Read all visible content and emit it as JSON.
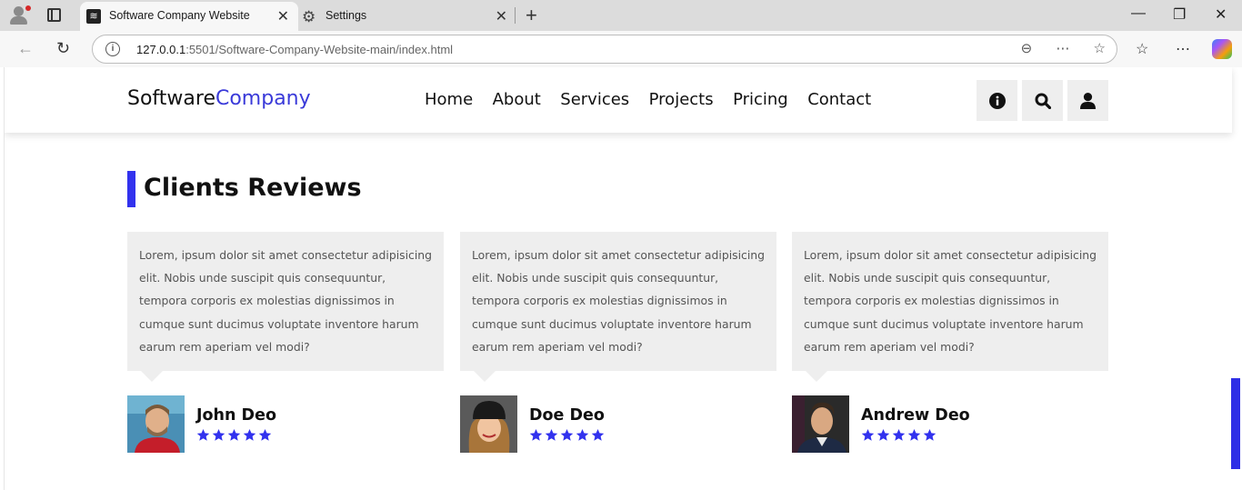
{
  "browser": {
    "tabs": [
      {
        "title": "Software Company Website",
        "active": true
      },
      {
        "title": "Settings",
        "active": false
      }
    ],
    "url_host": "127.0.0.1",
    "url_rest": ":5501/Software-Company-Website-main/index.html"
  },
  "site": {
    "logo_main": "Software",
    "logo_accent": "Company",
    "nav": [
      "Home",
      "About",
      "Services",
      "Projects",
      "Pricing",
      "Contact"
    ],
    "header_icons": [
      "info-icon",
      "search-icon",
      "user-icon"
    ],
    "accent_color": "#3232ee"
  },
  "reviews_section": {
    "title": "Clients Reviews",
    "reviews": [
      {
        "text": "Lorem, ipsum dolor sit amet consectetur adipisicing elit. Nobis unde suscipit quis consequuntur, tempora corporis ex molestias dignissimos in cumque sunt ducimus voluptate inventore harum earum rem aperiam vel modi?",
        "name": "John Deo",
        "stars": 5
      },
      {
        "text": "Lorem, ipsum dolor sit amet consectetur adipisicing elit. Nobis unde suscipit quis consequuntur, tempora corporis ex molestias dignissimos in cumque sunt ducimus voluptate inventore harum earum rem aperiam vel modi?",
        "name": "Doe Deo",
        "stars": 5
      },
      {
        "text": "Lorem, ipsum dolor sit amet consectetur adipisicing elit. Nobis unde suscipit quis consequuntur, tempora corporis ex molestias dignissimos in cumque sunt ducimus voluptate inventore harum earum rem aperiam vel modi?",
        "name": "Andrew Deo",
        "stars": 5
      }
    ]
  }
}
